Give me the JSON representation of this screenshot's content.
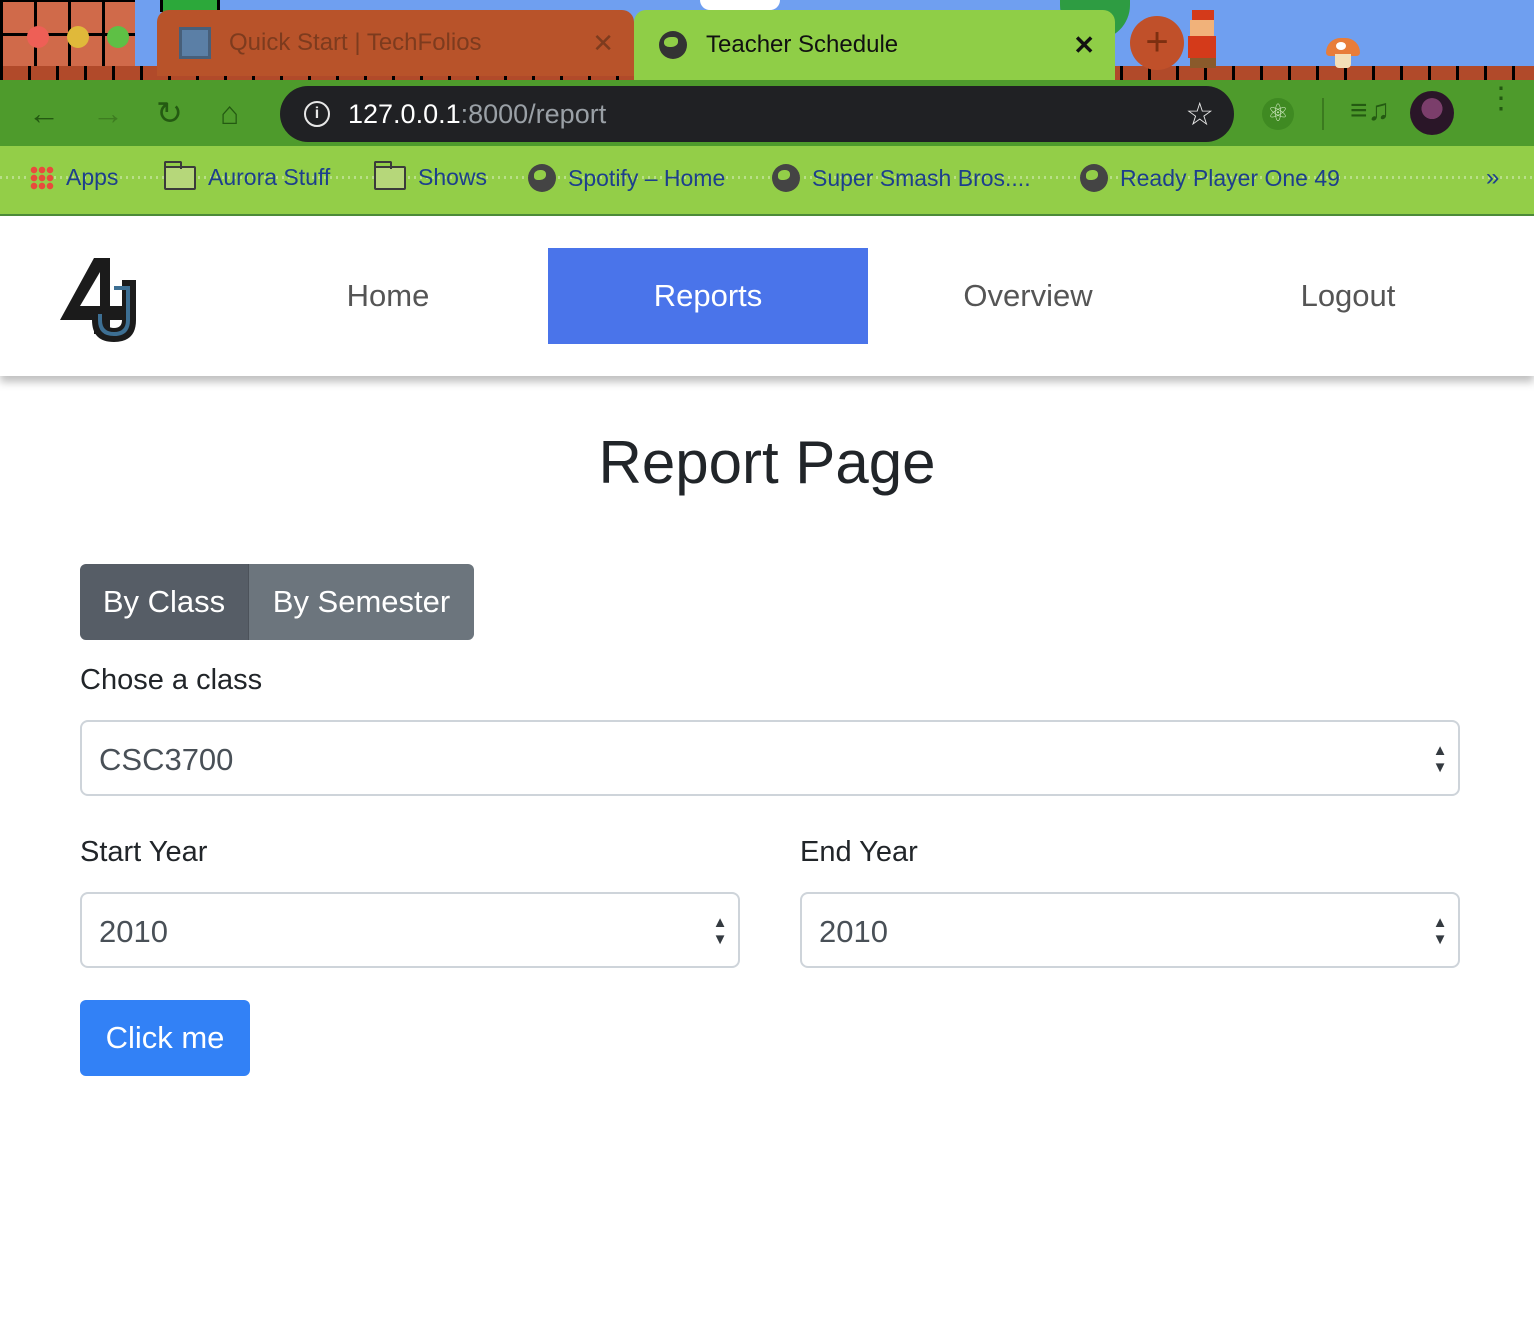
{
  "browser": {
    "tabs": [
      {
        "title": "Quick Start | TechFolios",
        "active": false,
        "close": "✕"
      },
      {
        "title": "Teacher Schedule",
        "active": true,
        "close": "✕"
      }
    ],
    "new_tab": "+",
    "url_host": "127.0.0.1",
    "url_path": ":8000/report",
    "info_glyph": "i",
    "bookmarks": [
      {
        "label": "Apps",
        "icon": "apps-grid-icon"
      },
      {
        "label": "Aurora Stuff",
        "icon": "folder-icon"
      },
      {
        "label": "Shows",
        "icon": "folder-icon"
      },
      {
        "label": "Spotify – Home",
        "icon": "globe-icon"
      },
      {
        "label": "Super Smash Bros....",
        "icon": "globe-icon"
      },
      {
        "label": "Ready Player One 49",
        "icon": "globe-icon"
      }
    ],
    "bookmarks_more": "»"
  },
  "site_nav": {
    "logo_text": "AU",
    "items": [
      {
        "label": "Home",
        "active": false
      },
      {
        "label": "Reports",
        "active": true
      },
      {
        "label": "Overview",
        "active": false
      },
      {
        "label": "Logout",
        "active": false
      }
    ],
    "active_color": "#4a74ea"
  },
  "main": {
    "title": "Report Page",
    "toggle": {
      "by_class": "By Class",
      "by_semester": "By Semester",
      "selected": "By Class"
    },
    "class_label": "Chose a class",
    "class_value": "CSC3700",
    "start_year_label": "Start Year",
    "start_year_value": "2010",
    "end_year_label": "End Year",
    "end_year_value": "2010",
    "submit_label": "Click me"
  },
  "colors": {
    "accent": "#3281f6",
    "segment_active": "#565d66",
    "segment": "#6c757d"
  }
}
